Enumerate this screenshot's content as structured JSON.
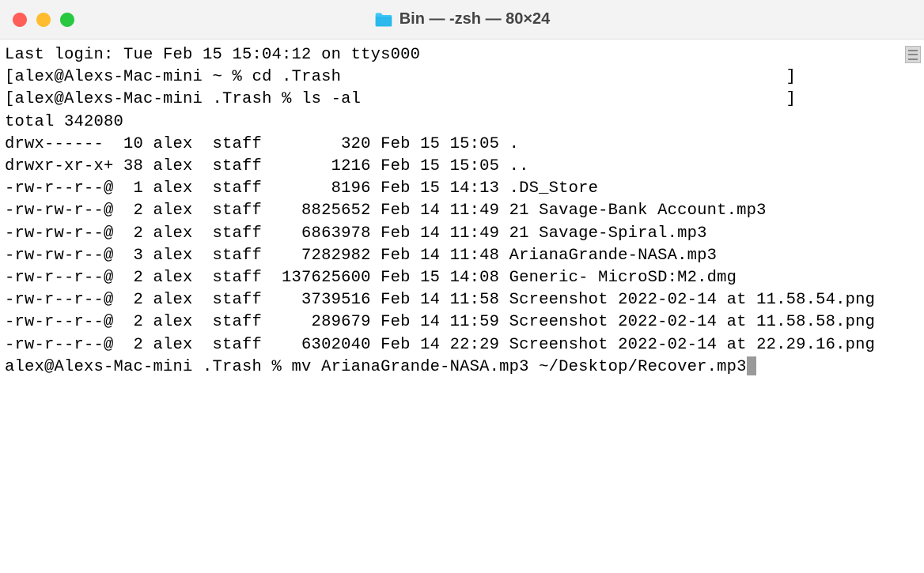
{
  "window": {
    "title": "Bin — -zsh — 80×24"
  },
  "terminal": {
    "last_login": "Last login: Tue Feb 15 15:04:12 on ttys000",
    "prompts": [
      {
        "lb": "[",
        "text": "alex@Alexs-Mac-mini ~ % cd .Trash",
        "rb": "]"
      },
      {
        "lb": "[",
        "text": "alex@Alexs-Mac-mini .Trash % ls -al",
        "rb": "]"
      }
    ],
    "total_line": "total 342080",
    "listing": [
      "drwx------  10 alex  staff        320 Feb 15 15:05 .",
      "drwxr-xr-x+ 38 alex  staff       1216 Feb 15 15:05 ..",
      "-rw-r--r--@  1 alex  staff       8196 Feb 15 14:13 .DS_Store",
      "-rw-rw-r--@  2 alex  staff    8825652 Feb 14 11:49 21 Savage-Bank Account.mp3",
      "-rw-rw-r--@  2 alex  staff    6863978 Feb 14 11:49 21 Savage-Spiral.mp3",
      "-rw-rw-r--@  3 alex  staff    7282982 Feb 14 11:48 ArianaGrande-NASA.mp3",
      "-rw-r--r--@  2 alex  staff  137625600 Feb 15 14:08 Generic- MicroSD:M2.dmg",
      "-rw-r--r--@  2 alex  staff    3739516 Feb 14 11:58 Screenshot 2022-02-14 at 11.58.54.png",
      "-rw-r--r--@  2 alex  staff     289679 Feb 14 11:59 Screenshot 2022-02-14 at 11.58.58.png",
      "-rw-r--r--@  2 alex  staff    6302040 Feb 14 22:29 Screenshot 2022-02-14 at 22.29.16.png"
    ],
    "current_prompt": "alex@Alexs-Mac-mini .Trash % mv ArianaGrande-NASA.mp3 ~/Desktop/Recover.mp3"
  }
}
